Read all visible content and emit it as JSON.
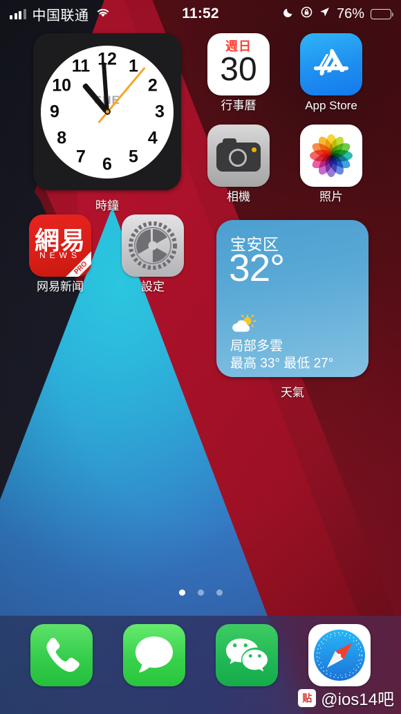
{
  "status_bar": {
    "carrier": "中国联通",
    "time": "11:52",
    "battery_percent": "76%",
    "battery_level": 76,
    "icons": [
      "signal-bars-icon",
      "wifi-icon",
      "do-not-disturb-moon-icon",
      "rotation-lock-icon",
      "location-arrow-icon",
      "battery-icon"
    ]
  },
  "widgets": {
    "clock": {
      "label": "時鐘",
      "city_code": "SHE",
      "numbers": [
        "12",
        "1",
        "2",
        "3",
        "4",
        "5",
        "6",
        "7",
        "8",
        "9",
        "10",
        "11"
      ],
      "hour_angle": -40,
      "minute_angle": -4,
      "second_angle": 40
    },
    "weather": {
      "label": "天氣",
      "city": "宝安区",
      "temperature": "32°",
      "condition": "局部多雲",
      "high_low": "最高 33° 最低 27°",
      "accent": "#5aa9d6"
    }
  },
  "apps": [
    {
      "name": "calendar",
      "label": "行事曆",
      "day_of_week": "週日",
      "day": "30"
    },
    {
      "name": "app-store",
      "label": "App Store"
    },
    {
      "name": "camera",
      "label": "相機"
    },
    {
      "name": "photos",
      "label": "照片"
    },
    {
      "name": "netease-news",
      "label": "网易新闻",
      "logo_cn": "網易",
      "logo_sub": "NEWS",
      "ribbon": "PRO"
    },
    {
      "name": "settings",
      "label": "設定"
    }
  ],
  "dock": [
    {
      "name": "phone",
      "label": "Phone"
    },
    {
      "name": "messages",
      "label": "Messages"
    },
    {
      "name": "wechat",
      "label": "WeChat"
    },
    {
      "name": "safari",
      "label": "Safari"
    }
  ],
  "page_dots": {
    "count": 3,
    "active_index": 0
  },
  "watermark": {
    "badge": "贴",
    "text": "@ios14吧"
  }
}
